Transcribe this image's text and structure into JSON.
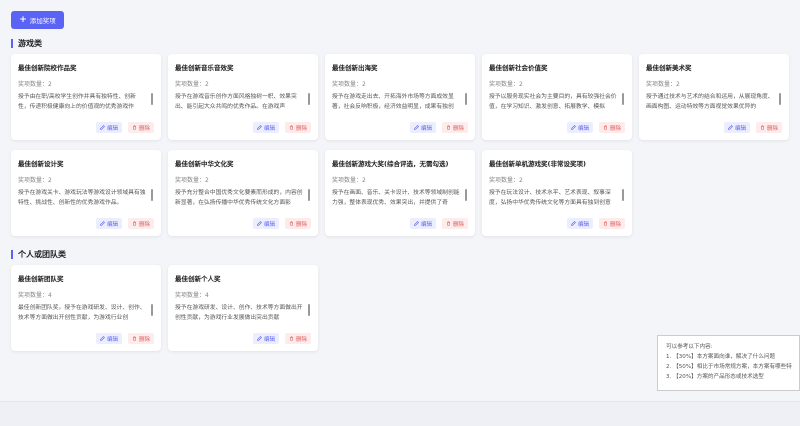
{
  "toolbar": {
    "add_label": "添加奖项"
  },
  "sections": [
    {
      "title": "游戏类"
    },
    {
      "title": "个人或团队类"
    }
  ],
  "card_common": {
    "edit_label": "编辑",
    "delete_label": "删除"
  },
  "cards": [
    {
      "title": "最佳创新院校作品奖",
      "count": "奖项数量：2",
      "desc": "授予由在职/高校学生创作并具有独特性、创新性，传递积极健康向上的价值观的优秀游戏作"
    },
    {
      "title": "最佳创新音乐音效奖",
      "count": "奖项数量：2",
      "desc": "授予在游戏音乐创作方面风格独树一帜、效果突出、能引起大众共鸣的优秀作品。在游戏声"
    },
    {
      "title": "最佳创新出海奖",
      "count": "奖项数量：2",
      "desc": "授予在游戏走出去、开拓海外市场等方面成效显著，社会反响积极，经济效益明显，成果有独创"
    },
    {
      "title": "最佳创新社会价值奖",
      "count": "奖项数量：2",
      "desc": "授予以服务现实社会为主要目的，具有较强社会价值，在学习知识、激发创意、拓展教学、模拟"
    },
    {
      "title": "最佳创新美术奖",
      "count": "奖项数量：2",
      "desc": "授予通过技术与艺术的结合和运用，从展现角度、画面构图、运动特效等方面视觉效果优异的"
    },
    {
      "title": "最佳创新设计奖",
      "count": "奖项数量：2",
      "desc": "授予在游戏关卡、游戏玩法等游戏设计领域具有独特性、挑战性、创新性的优秀游戏作品。"
    },
    {
      "title": "最佳创新中华文化奖",
      "count": "奖项数量：2",
      "desc": "授予充分整合中国优秀文化要素而形成的，内容创新显著，在弘扬传播中华优秀传统文化方面影"
    },
    {
      "title": "最佳创新游戏大奖(综合评选，无需勾选)",
      "count": "奖项数量：2",
      "desc": "授予在画面、音乐、关卡设计、技术等领域制创能力强，整体表现优秀、效果突出，并提供了奇"
    },
    {
      "title": "最佳创新单机游戏奖(非常设奖项)",
      "count": "奖项数量：2",
      "desc": "授予在玩法设计、技术水平、艺术表现、叙事深度，弘扬中华优秀传统文化等方面具有独到创意"
    },
    {
      "title": "最佳创新团队奖",
      "count": "奖项数量：4",
      "desc": "最佳创新团队奖。授予在游戏研发、设计、创作、技术等方面做出开创性贡献，为游戏行业创"
    },
    {
      "title": "最佳创新个人奖",
      "count": "奖项数量：4",
      "desc": "授予在游戏研发、设计、创作、技术等方面做出开创性贡献，为游戏行业发展做出突出贡献"
    }
  ],
  "hint": {
    "title": "可以参考以下内容:",
    "lines": [
      "1. 【30%】本方案面向谁，解决了什么问题",
      "2. 【50%】相比于市场常规方案，本方案有哪些特",
      "3. 【20%】方案的产品形态或技术选型"
    ]
  }
}
